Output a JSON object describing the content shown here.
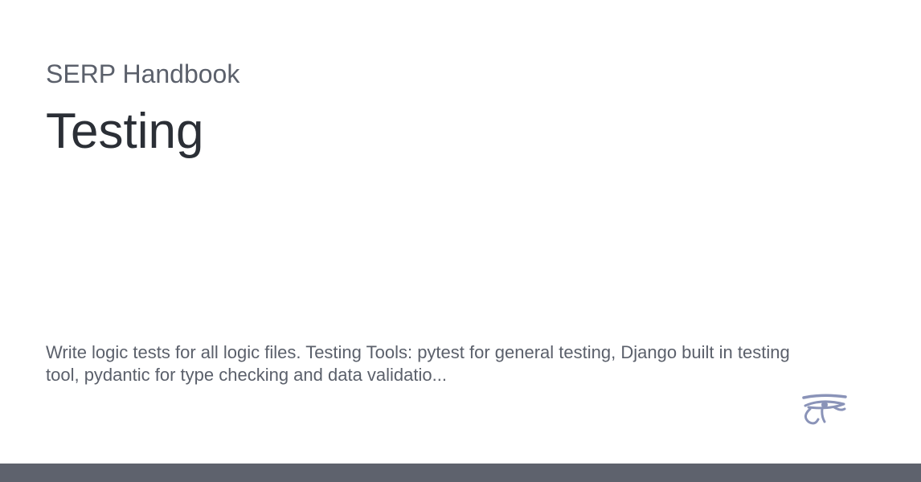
{
  "site": {
    "name": "SERP Handbook"
  },
  "page": {
    "title": "Testing",
    "description": "Write logic tests for all logic files. Testing Tools: pytest for general testing, Django built in testing tool, pydantic for type checking and data validatio..."
  },
  "logo": {
    "icon": "eye-of-horus-icon",
    "color": "#8a93b8"
  },
  "footer": {
    "color": "#5e626d"
  }
}
